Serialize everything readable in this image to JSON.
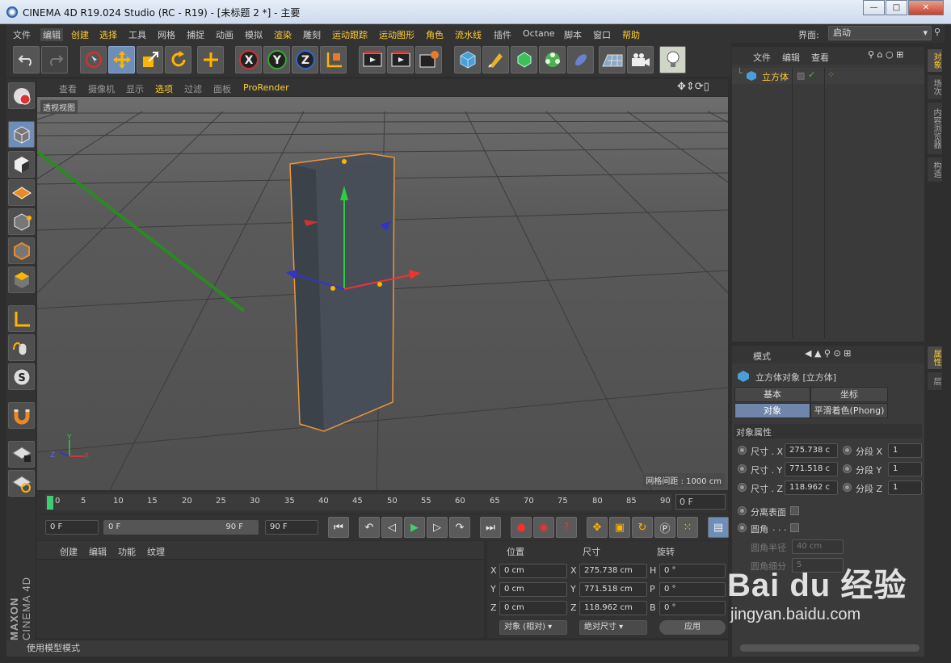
{
  "window": {
    "title": "CINEMA 4D R19.024 Studio (RC - R19) - [未标题 2 *] - 主要"
  },
  "menu": {
    "items": [
      "文件",
      "编辑",
      "创建",
      "选择",
      "工具",
      "网格",
      "捕捉",
      "动画",
      "模拟",
      "渲染",
      "雕刻",
      "运动跟踪",
      "运动图形",
      "角色",
      "流水线",
      "插件",
      "Octane",
      "脚本",
      "窗口",
      "帮助"
    ],
    "layout_label": "界面:",
    "layout_value": "启动"
  },
  "viewport": {
    "menu": [
      "查看",
      "摄像机",
      "显示",
      "选项",
      "过滤",
      "面板",
      "ProRender"
    ],
    "label": "透视视图",
    "grid_info": "网格间距 : 1000 cm"
  },
  "timeline": {
    "ticks": [
      "0",
      "5",
      "10",
      "15",
      "20",
      "25",
      "30",
      "35",
      "40",
      "45",
      "50",
      "55",
      "60",
      "65",
      "70",
      "75",
      "80",
      "85",
      "90"
    ],
    "current_frame": "0 F"
  },
  "transport": {
    "start": "0 F",
    "range_start": "0 F",
    "range_end": "90 F",
    "end": "90 F"
  },
  "material_panel": {
    "menu": [
      "创建",
      "编辑",
      "功能",
      "纹理"
    ]
  },
  "coords": {
    "headers": [
      "位置",
      "尺寸",
      "旋转"
    ],
    "rows": [
      {
        "axis": "X",
        "pos": "0 cm",
        "size_axis": "X",
        "size": "275.738 cm",
        "rot_axis": "H",
        "rot": "0 °"
      },
      {
        "axis": "Y",
        "pos": "0 cm",
        "size_axis": "Y",
        "size": "771.518 cm",
        "rot_axis": "P",
        "rot": "0 °"
      },
      {
        "axis": "Z",
        "pos": "0 cm",
        "size_axis": "Z",
        "size": "118.962 cm",
        "rot_axis": "B",
        "rot": "0 °"
      }
    ],
    "mode": "对象 (相对)",
    "size_mode": "绝对尺寸",
    "apply": "应用"
  },
  "status": {
    "text": "使用模型模式"
  },
  "object_manager": {
    "menu": [
      "文件",
      "编辑",
      "查看"
    ],
    "object_name": "立方体"
  },
  "attribute_manager": {
    "mode": "模式",
    "object_title": "立方体对象 [立方体]",
    "tabs": [
      "基本",
      "坐标",
      "对象",
      "平滑着色(Phong)"
    ],
    "section": "对象属性",
    "props": [
      {
        "label": "尺寸 . X",
        "value": "275.738 c",
        "seg_label": "分段 X",
        "seg": "1"
      },
      {
        "label": "尺寸 . Y",
        "value": "771.518 c",
        "seg_label": "分段 Y",
        "seg": "1"
      },
      {
        "label": "尺寸 . Z",
        "value": "118.962 c",
        "seg_label": "分段 Z",
        "seg": "1"
      }
    ],
    "separate_surfaces": "分离表面",
    "fillet": "圆角",
    "fillet_radius_label": "圆角半径",
    "fillet_radius": "40 cm",
    "fillet_subdiv_label": "圆角细分",
    "fillet_subdiv": "5"
  },
  "side_tabs": {
    "right_top": [
      "对象",
      "场次",
      "内容浏览器",
      "构造"
    ],
    "right_bottom": [
      "属性",
      "层"
    ]
  },
  "branding": {
    "maxon": "MAXON",
    "cinema": "CINEMA 4D"
  },
  "watermark": {
    "text": "Bai du 经验",
    "url": "jingyan.baidu.com"
  },
  "colors": {
    "accent": "#ffcc33",
    "selection": "#6e8eb8",
    "object_outline": "#e8963a"
  }
}
